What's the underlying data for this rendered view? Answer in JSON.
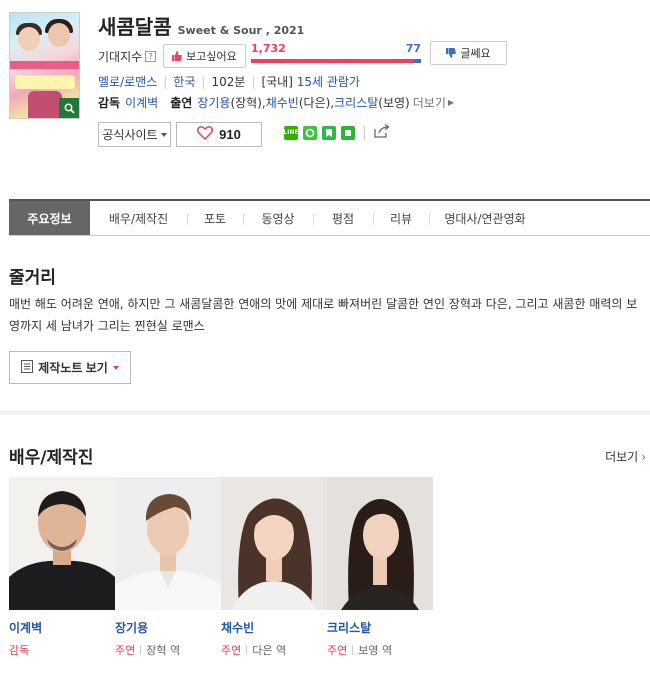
{
  "movie": {
    "title": "새콤달콤",
    "subtitle": "Sweet & Sour , 2021",
    "expect_label": "기대지수",
    "want_label": "보고싶어요",
    "want_count": "1,732",
    "dislike_count": "77",
    "dislike_label": "글쎄요",
    "want_ratio": 0.957,
    "genre": "멜로/로맨스",
    "country": "한국",
    "runtime": "102분",
    "rating_prefix": "[국내]",
    "rating": "15세 관람가",
    "director_label": "감독",
    "director": "이계벽",
    "cast_label": "출연",
    "cast": [
      {
        "name": "장기용",
        "role": "(장혁)",
        "sep": ", "
      },
      {
        "name": "채수빈",
        "role": "(다은)",
        "sep": ", "
      },
      {
        "name": "크리스탈",
        "role": "(보영)",
        "sep": ""
      }
    ],
    "more_label": "더보기",
    "official_site_label": "공식사이트",
    "like_count": "910"
  },
  "tabs": [
    "주요정보",
    "배우/제작진",
    "포토",
    "동영상",
    "평점",
    "리뷰",
    "명대사/연관영화"
  ],
  "synopsis": {
    "heading": "줄거리",
    "text": "매번 해도 어려운 연애, 하지만 그 새콤달콤한 연애의 맛에 제대로 빠져버린 달콤한 연인 장혁과 다은, 그리고 새콤한 매력의 보영까지 세 남녀가 그리는 찐현실 로맨스",
    "notes_button": "제작노트 보기"
  },
  "cast_section": {
    "heading": "배우/제작진",
    "more_label": "더보기",
    "people": [
      {
        "name": "이계벽",
        "role_type": "감독",
        "character": ""
      },
      {
        "name": "장기용",
        "role_type": "주연",
        "character": "장혁 역"
      },
      {
        "name": "채수빈",
        "role_type": "주연",
        "character": "다은 역"
      },
      {
        "name": "크리스탈",
        "role_type": "주연",
        "character": "보영 역"
      }
    ]
  },
  "colors": {
    "accent_red": "#ef4060",
    "link_blue": "#2554a9",
    "dislike_blue": "#3e6fc7"
  }
}
